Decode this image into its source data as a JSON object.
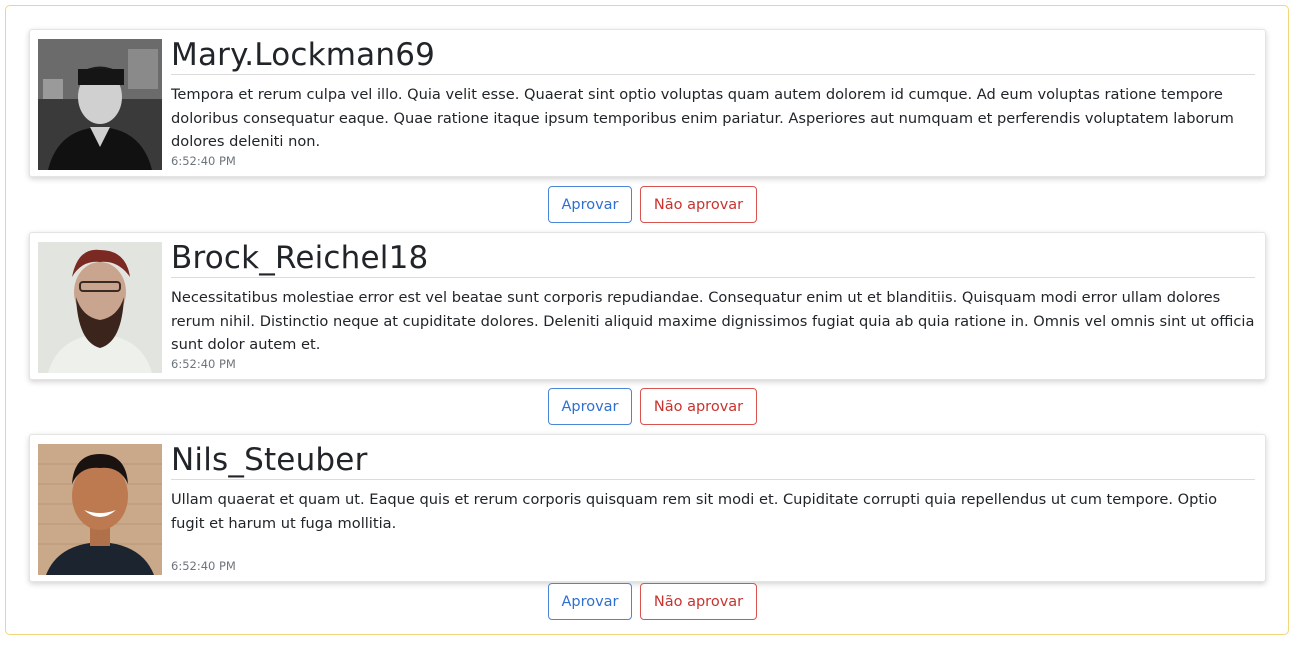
{
  "comments": [
    {
      "username": "Mary.Lockman69",
      "text": "Tempora et rerum culpa vel illo. Quia velit esse. Quaerat sint optio voluptas quam autem dolorem id cumque. Ad eum voluptas ratione tempore doloribus consequatur eaque. Quae ratione itaque ipsum temporibus enim pariatur. Asperiores aut numquam et perferendis voluptatem laborum dolores deleniti non.",
      "time": "6:52:40 PM",
      "approve_label": "Aprovar",
      "reject_label": "Não aprovar"
    },
    {
      "username": "Brock_Reichel18",
      "text": "Necessitatibus molestiae error est vel beatae sunt corporis repudiandae. Consequatur enim ut et blanditiis. Quisquam modi error ullam dolores rerum nihil. Distinctio neque at cupiditate dolores. Deleniti aliquid maxime dignissimos fugiat quia ab quia ratione in. Omnis vel omnis sint ut officia sunt dolor autem et.",
      "time": "6:52:40 PM",
      "approve_label": "Aprovar",
      "reject_label": "Não aprovar"
    },
    {
      "username": "Nils_Steuber",
      "text": "Ullam quaerat et quam ut. Eaque quis et rerum corporis quisquam rem sit modi et. Cupiditate corrupti quia repellendus ut cum tempore. Optio fugit et harum ut fuga mollitia.",
      "time": "6:52:40 PM",
      "approve_label": "Aprovar",
      "reject_label": "Não aprovar"
    }
  ],
  "colors": {
    "approve": "#2f6fcf",
    "reject": "#c8332e",
    "frame": "#f1d77a"
  }
}
